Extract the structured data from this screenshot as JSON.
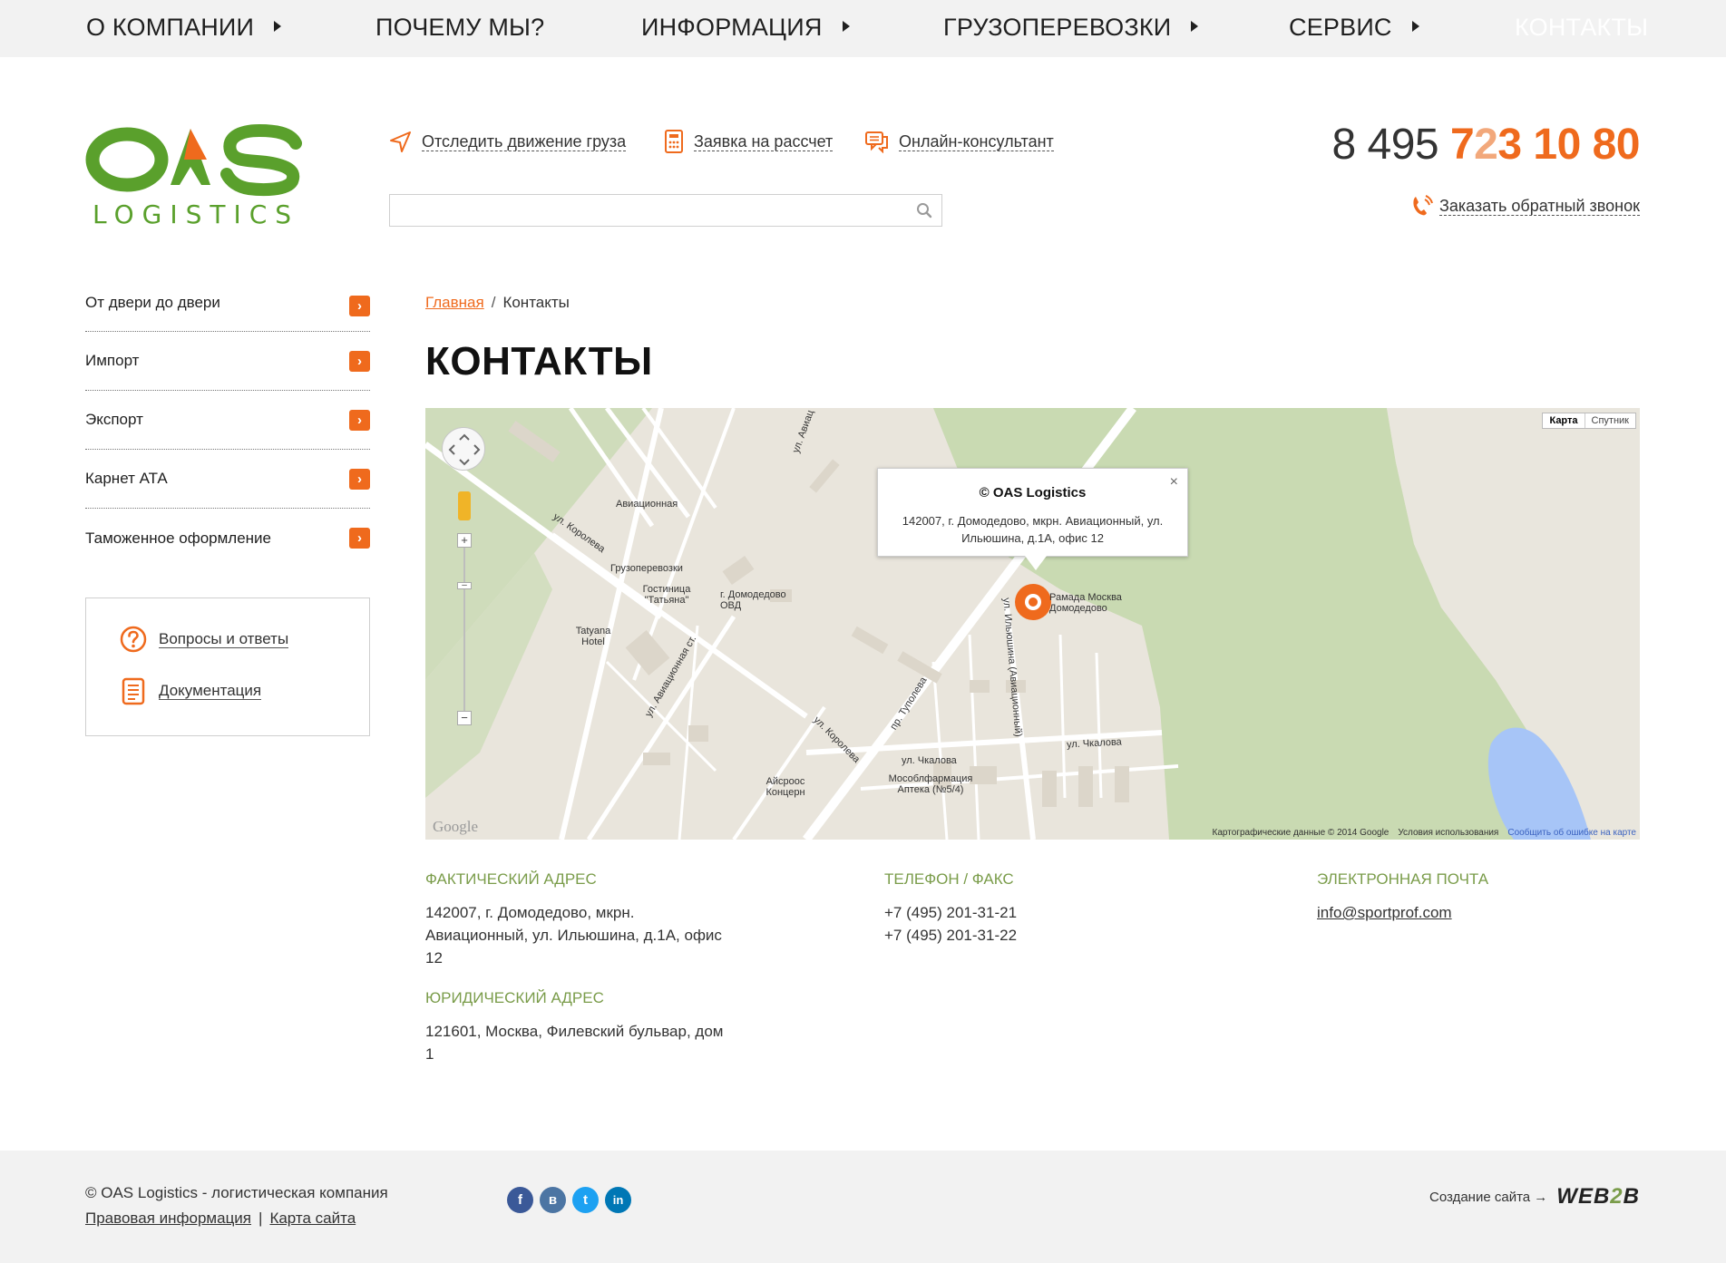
{
  "nav": {
    "items": [
      {
        "label": "О компании",
        "has_arrow": true
      },
      {
        "label": "Почему мы?",
        "has_arrow": false
      },
      {
        "label": "Информация",
        "has_arrow": true
      },
      {
        "label": "Грузоперевозки",
        "has_arrow": true
      },
      {
        "label": "Сервис",
        "has_arrow": true
      },
      {
        "label": "Контакты",
        "has_arrow": false,
        "active": true
      }
    ]
  },
  "header": {
    "logo": {
      "text_main": "OAS",
      "text_sub": "LOGISTICS",
      "green": "#5aa02c",
      "orange": "#ef6a1d"
    },
    "links": {
      "track": "Отследить движение груза",
      "request": "Заявка на рассчет",
      "consultant": "Онлайн-консультант"
    },
    "search_placeholder": "",
    "phone": {
      "prefix": "8 495",
      "part1": "7",
      "part2": "2",
      "part3": "3 10 80"
    },
    "callback": "Заказать обратный звонок"
  },
  "sidebar": {
    "items": [
      {
        "label": "От двери до двери"
      },
      {
        "label": "Импорт"
      },
      {
        "label": "Экспорт"
      },
      {
        "label": "Карнет АТА"
      },
      {
        "label": "Таможенное оформление"
      }
    ],
    "box": {
      "faq": "Вопросы и ответы",
      "docs": "Документация"
    }
  },
  "main": {
    "breadcrumb": {
      "home": "Главная",
      "sep": "/",
      "current": "Контакты"
    },
    "title": "КОНТАКТЫ",
    "map": {
      "type_map": "Карта",
      "type_sat": "Спутник",
      "info_title": "© OAS Logistics",
      "info_address": "142007, г. Домодедово, мкрн. Авиационный, ул. Ильюшина, д.1А, офис 12",
      "close": "×",
      "google": "Google",
      "copyright": "Картографические данные © 2014 Google",
      "terms": "Условия использования",
      "report": "Сообщить об ошибке на карте",
      "labels": {
        "aviatsionnaya": "Авиационная",
        "korolyova1": "ул. Королева",
        "gruzoperevozki": "Грузоперевозки",
        "gostinitsa": "Гостиница \"Татьяна\"",
        "ovd": "г. Домодедово ОВД",
        "tatyana": "Tatyana Hotel",
        "aviatsionnaya_st": "ул. Авиационная ст.",
        "korolyova2": "ул. Королева",
        "airoos": "Айсроос Концерн",
        "tupoleva": "пр. Туполева",
        "ilyushina": "ул. Ильюшина (Авиационный)",
        "ramada": "Рамада Москва Домодедово",
        "chkalova1": "ул. Чкалова",
        "chkalova2": "ул. Чкалова",
        "mosoblfarm": "Мособлфармация Аптека (№5/4)",
        "avia_top": "ул. Авиац"
      }
    },
    "contacts": {
      "fact_h": "Фактический адрес",
      "fact_t": "142007, г. Домодедово, мкрн.\nАвиационный, ул. Ильюшина, д.1А, офис\n12",
      "legal_h": "Юридический адрес",
      "legal_t": "121601, Москва, Филевский бульвар, дом\n1",
      "phone_h": "Телефон / факс",
      "phone_t": "+7 (495) 201-31-21\n+7 (495) 201-31-22",
      "email_h": "Электронная почта",
      "email_t": "info@sportprof.com"
    }
  },
  "footer": {
    "copy": "© OAS Logistics - логистическая компания",
    "legal": "Правовая информация",
    "sep": "|",
    "sitemap": "Карта сайта",
    "social": [
      {
        "name": "facebook-icon",
        "glyph": "f",
        "color": "#3b5998"
      },
      {
        "name": "vkontakte-icon",
        "glyph": "в",
        "color": "#4c75a3"
      },
      {
        "name": "twitter-icon",
        "glyph": "t",
        "color": "#1da1f2"
      },
      {
        "name": "linkedin-icon",
        "glyph": "in",
        "color": "#0077b5"
      }
    ],
    "credit": "Создание сайта →",
    "brand_a": "WEB",
    "brand_b": "2",
    "brand_c": "B"
  }
}
